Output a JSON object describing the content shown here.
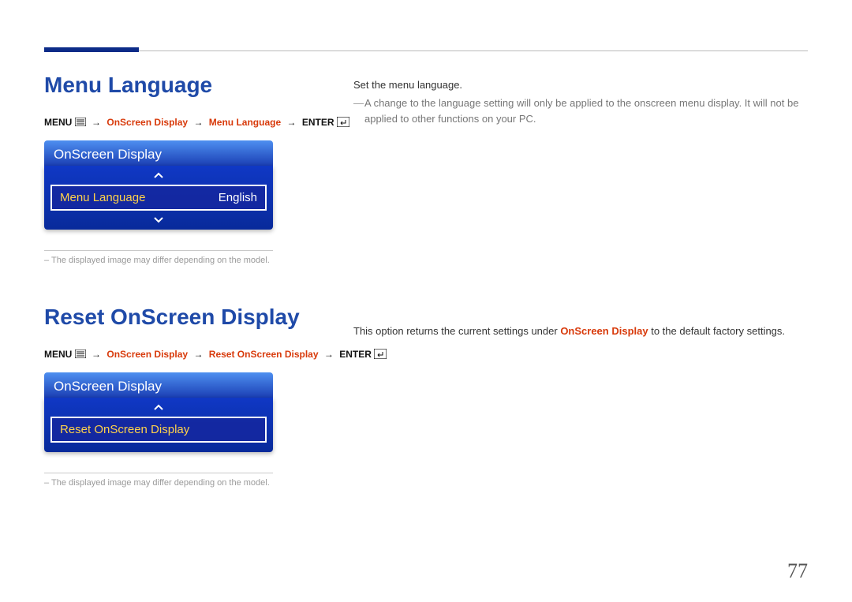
{
  "section1": {
    "title": "Menu Language",
    "path": {
      "menu": "MENU",
      "p1": "OnScreen Display",
      "p2": "Menu Language",
      "enter": "ENTER"
    },
    "osd": {
      "header": "OnScreen Display",
      "item_label": "Menu Language",
      "item_value": "English"
    },
    "footnote": "The displayed image may differ depending on the model.",
    "right": {
      "line1": "Set the menu language.",
      "note": "A change to the language setting will only be applied to the onscreen menu display. It will not be applied to other functions on your PC."
    }
  },
  "section2": {
    "title": "Reset OnScreen Display",
    "path": {
      "menu": "MENU",
      "p1": "OnScreen Display",
      "p2": "Reset OnScreen Display",
      "enter": "ENTER"
    },
    "osd": {
      "header": "OnScreen Display",
      "item_label": "Reset OnScreen Display"
    },
    "footnote": "The displayed image may differ depending on the model.",
    "right": {
      "prefix": "This option returns the current settings under ",
      "em": "OnScreen Display",
      "suffix": " to the default factory settings."
    }
  },
  "pageNumber": "77"
}
